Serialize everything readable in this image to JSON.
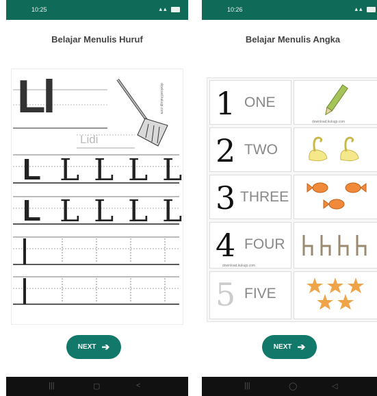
{
  "left_screen": {
    "status_time": "10:25",
    "title": "Belajar Menulis Huruf",
    "worksheet": {
      "letter_big": "Ll",
      "word": "Lidi",
      "trace_letter": "L",
      "credit": "dowload.kukujp.com"
    },
    "next_label": "NEXT"
  },
  "right_screen": {
    "status_time": "10:26",
    "title": "Belajar Menulis Angka",
    "numbers": [
      {
        "numeral": "1",
        "word": "ONE",
        "picture": "pencil-icon"
      },
      {
        "numeral": "2",
        "word": "TWO",
        "picture": "swan-icon"
      },
      {
        "numeral": "3",
        "word": "THREE",
        "picture": "fish-icon"
      },
      {
        "numeral": "4",
        "word": "FOUR",
        "picture": "chair-icon"
      },
      {
        "numeral": "5",
        "word": "FIVE",
        "picture": "star-icon"
      }
    ],
    "credit": "download.kukujp.com",
    "next_label": "NEXT"
  },
  "colors": {
    "statusbar": "#0f6a58",
    "button": "#11786a",
    "navbar": "#111111",
    "star": "#f0a44a",
    "fish": "#f08a3a"
  }
}
